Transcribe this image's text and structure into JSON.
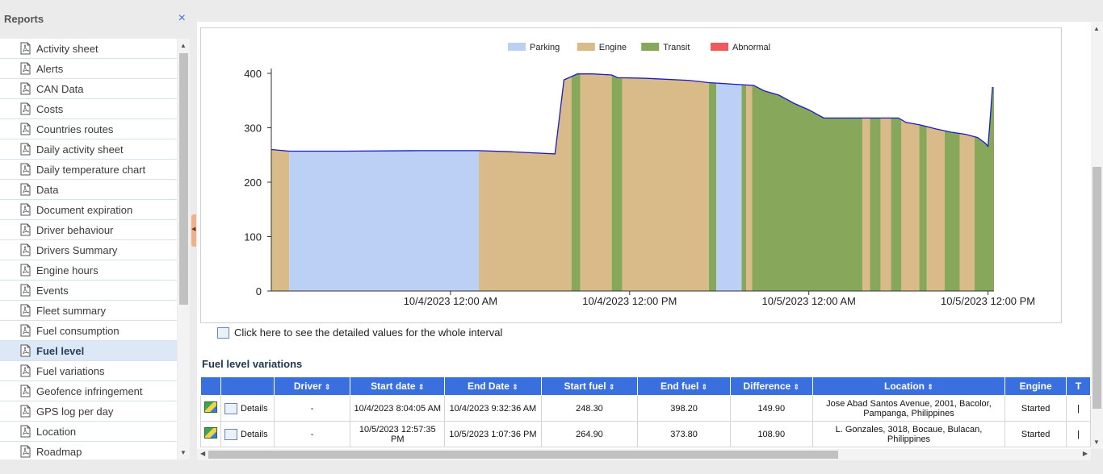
{
  "sidebar": {
    "title": "Reports",
    "close_glyph": "×",
    "items": [
      {
        "label": "Activity sheet"
      },
      {
        "label": "Alerts"
      },
      {
        "label": "CAN Data"
      },
      {
        "label": "Costs"
      },
      {
        "label": "Countries routes"
      },
      {
        "label": "Daily activity sheet"
      },
      {
        "label": "Daily temperature chart"
      },
      {
        "label": "Data"
      },
      {
        "label": "Document expiration"
      },
      {
        "label": "Driver behaviour"
      },
      {
        "label": "Drivers Summary"
      },
      {
        "label": "Engine hours"
      },
      {
        "label": "Events"
      },
      {
        "label": "Fleet summary"
      },
      {
        "label": "Fuel consumption"
      },
      {
        "label": "Fuel level",
        "active": true
      },
      {
        "label": "Fuel variations"
      },
      {
        "label": "Geofence infringement"
      },
      {
        "label": "GPS log per day"
      },
      {
        "label": "Location"
      },
      {
        "label": "Roadmap"
      }
    ],
    "item_icon": "pdf-file-icon"
  },
  "main": {
    "detail_link": "Click here to see the detailed values for the whole interval",
    "section_title": "Fuel level variations",
    "table": {
      "headers": [
        "",
        "",
        "Driver",
        "Start date",
        "End Date",
        "Start fuel",
        "End fuel",
        "Difference",
        "Location",
        "Engine",
        "T"
      ],
      "rows": [
        {
          "details": "Details",
          "driver": "-",
          "start_date": "10/4/2023 8:04:05 AM",
          "end_date": "10/4/2023 9:32:36 AM",
          "start_fuel": "248.30",
          "end_fuel": "398.20",
          "difference": "149.90",
          "location": "Jose Abad Santos Avenue,  2001, Bacolor, Pampanga, Philippines",
          "engine": "Started"
        },
        {
          "details": "Details",
          "driver": "-",
          "start_date": "10/5/2023 12:57:35 PM",
          "end_date": "10/5/2023 1:07:36 PM",
          "start_fuel": "264.90",
          "end_fuel": "373.80",
          "difference": "108.90",
          "location": "L. Gonzales,  3018, Bocaue, Bulacan, Philippines",
          "engine": "Started"
        }
      ]
    }
  },
  "chart_data": {
    "type": "area",
    "legend": [
      {
        "name": "Parking",
        "color": "#bcd0f5"
      },
      {
        "name": "Engine",
        "color": "#d9bb8a"
      },
      {
        "name": "Transit",
        "color": "#87a85a"
      },
      {
        "name": "Abnormal",
        "color": "#ef5a5a"
      }
    ],
    "legend_position": "top-center",
    "line_color": "#1a1acc",
    "yticks": [
      0,
      100,
      200,
      300,
      400
    ],
    "ylim": [
      0,
      400
    ],
    "xticks": [
      "10/4/2023 12:00 AM",
      "10/4/2023 12:00 PM",
      "10/5/2023 12:00 AM",
      "10/5/2023 12:00 PM"
    ],
    "x_unit": "hours from 10/3/2023 12:00 PM",
    "xlim": [
      0,
      48.4
    ],
    "grid": false,
    "segments": [
      {
        "state": "Engine",
        "x0": 0.0,
        "x1": 1.2
      },
      {
        "state": "Parking",
        "x0": 1.2,
        "x1": 13.9
      },
      {
        "state": "Engine",
        "x0": 13.9,
        "x1": 20.1
      },
      {
        "state": "Transit",
        "x0": 20.1,
        "x1": 20.7
      },
      {
        "state": "Engine",
        "x0": 20.7,
        "x1": 22.8
      },
      {
        "state": "Transit",
        "x0": 22.8,
        "x1": 23.5
      },
      {
        "state": "Engine",
        "x0": 23.5,
        "x1": 29.3
      },
      {
        "state": "Transit",
        "x0": 29.3,
        "x1": 29.8
      },
      {
        "state": "Parking",
        "x0": 29.8,
        "x1": 31.5
      },
      {
        "state": "Transit",
        "x0": 31.5,
        "x1": 31.8
      },
      {
        "state": "Engine",
        "x0": 31.8,
        "x1": 32.2
      },
      {
        "state": "Transit",
        "x0": 32.2,
        "x1": 39.6
      },
      {
        "state": "Engine",
        "x0": 39.6,
        "x1": 40.1
      },
      {
        "state": "Transit",
        "x0": 40.1,
        "x1": 40.8
      },
      {
        "state": "Engine",
        "x0": 40.8,
        "x1": 41.5
      },
      {
        "state": "Transit",
        "x0": 41.5,
        "x1": 42.2
      },
      {
        "state": "Engine",
        "x0": 42.2,
        "x1": 43.4
      },
      {
        "state": "Transit",
        "x0": 43.4,
        "x1": 43.9
      },
      {
        "state": "Engine",
        "x0": 43.9,
        "x1": 45.1
      },
      {
        "state": "Transit",
        "x0": 45.1,
        "x1": 46.1
      },
      {
        "state": "Engine",
        "x0": 46.1,
        "x1": 47.1
      },
      {
        "state": "Transit",
        "x0": 47.1,
        "x1": 48.4
      }
    ],
    "series": [
      {
        "points": [
          [
            0,
            260
          ],
          [
            1.2,
            257
          ],
          [
            5,
            257
          ],
          [
            10,
            258
          ],
          [
            13.9,
            258
          ],
          [
            16,
            256
          ],
          [
            19,
            252
          ],
          [
            19.6,
            388
          ],
          [
            20.5,
            399
          ],
          [
            21.5,
            399
          ],
          [
            22.8,
            397
          ],
          [
            23.2,
            392
          ],
          [
            25,
            391
          ],
          [
            28,
            387
          ],
          [
            29.3,
            383
          ],
          [
            31,
            380
          ],
          [
            32.3,
            378
          ],
          [
            33,
            368
          ],
          [
            34,
            360
          ],
          [
            35,
            345
          ],
          [
            36,
            333
          ],
          [
            37,
            318
          ],
          [
            39.6,
            318
          ],
          [
            42,
            318
          ],
          [
            42.5,
            310
          ],
          [
            43.5,
            305
          ],
          [
            44.5,
            298
          ],
          [
            45.5,
            292
          ],
          [
            46.5,
            288
          ],
          [
            47.3,
            282
          ],
          [
            47.8,
            272
          ],
          [
            48.0,
            266
          ],
          [
            48.1,
            300
          ],
          [
            48.3,
            375
          ]
        ]
      }
    ]
  }
}
